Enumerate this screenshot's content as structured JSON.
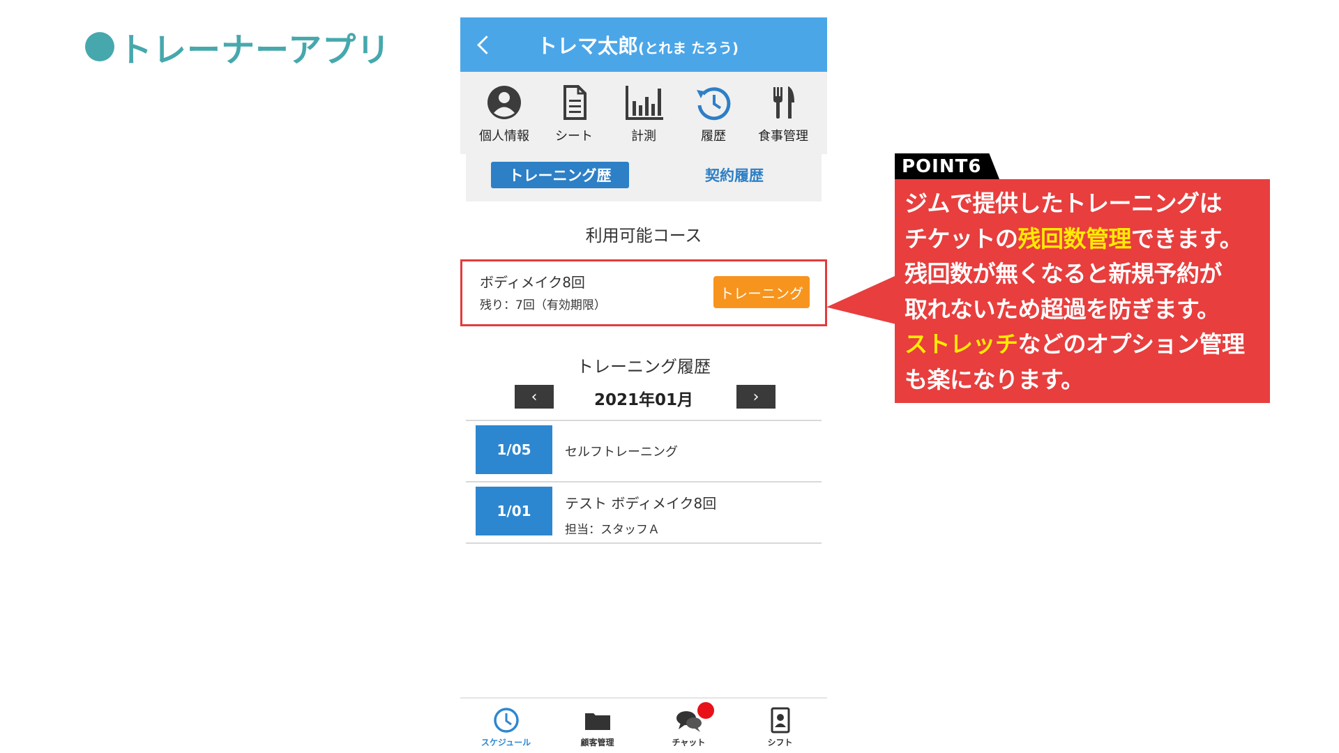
{
  "slide": {
    "title": "トレーナーアプリ"
  },
  "header": {
    "name": "トレマ太郎",
    "kana": "(とれま たろう)"
  },
  "icon_menu": [
    {
      "label": "個人情報",
      "icon": "person-circle-icon"
    },
    {
      "label": "シート",
      "icon": "document-icon"
    },
    {
      "label": "計測",
      "icon": "bar-chart-icon"
    },
    {
      "label": "履歴",
      "icon": "history-icon"
    },
    {
      "label": "食事管理",
      "icon": "fork-knife-icon"
    }
  ],
  "tabs": {
    "active": "トレーニング歴",
    "inactive": "契約履歴"
  },
  "available_courses": {
    "title": "利用可能コース",
    "course": {
      "name": "ボディメイク8回",
      "remaining": "残り：7回（有効期限）",
      "button": "トレーニング"
    }
  },
  "history": {
    "title": "トレーニング履歴",
    "month": "2021年01月",
    "prev": "‹",
    "next": "›",
    "rows": [
      {
        "date": "1/05",
        "title": "セルフトレーニング",
        "sub": ""
      },
      {
        "date": "1/01",
        "title": "テスト ボディメイク8回",
        "sub": "担当：スタッフＡ"
      }
    ]
  },
  "bottom_nav": [
    {
      "label": "スケジュール",
      "icon": "clock-icon",
      "active": true
    },
    {
      "label": "顧客管理",
      "icon": "folder-icon",
      "active": false
    },
    {
      "label": "チャット",
      "icon": "chat-bubbles-icon",
      "active": false
    },
    {
      "label": "シフト",
      "icon": "id-badge-icon",
      "active": false
    }
  ],
  "callout": {
    "tag": "POINT6",
    "line1": "ジムで提供したトレーニングは",
    "line2_pre": "チケットの",
    "line2_hl": "残回数管理",
    "line2_post": "できます。",
    "line3": "残回数が無くなると新規予約が",
    "line4": "取れないため超過を防ぎます。",
    "line5_hl": "ストレッチ",
    "line5_post": "などのオプション管理",
    "line6": "も楽になります。"
  },
  "colors": {
    "title_teal": "#46a8ad",
    "header_blue": "#4ba6e8",
    "tab_blue": "#2d7fc6",
    "badge_blue": "#2d87d0",
    "orange_button": "#f7941d",
    "highlight_red": "#e23b3b",
    "callout_red": "#e83e3e",
    "callout_highlight": "#ffea00",
    "notification_red": "#e8111a"
  }
}
